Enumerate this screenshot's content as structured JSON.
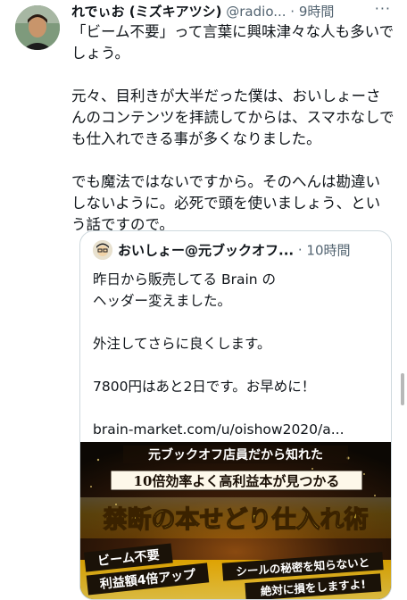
{
  "tweet": {
    "author_name": "れでぃお (ミズキアツシ)",
    "author_handle": "@radio...",
    "separator": " · ",
    "time": "9時間",
    "more": "···",
    "body": "「ビーム不要」って言葉に興味津々な人も多いでしょう。\n\n元々、目利きが大半だった僕は、おいしょーさんのコンテンツを拝読してからは、スマホなしでも仕入れできる事が多くなりました。\n\nでも魔法ではないですから。そのへんは勘違いしないように。必死で頭を使いましょう、という話ですので。"
  },
  "quote": {
    "author_name": "おいしょー@元ブックオフ...",
    "separator": " · ",
    "time": "10時間",
    "body": "昨日から販売してる Brain の\nヘッダー変えました。\n\n外注してさらに良くします。\n\n7800円はあと2日です。お早めに！\n\nbrain-market.com/u/oishow2020/a..."
  },
  "banner": {
    "line1": "元ブックオフ店員だから知れた",
    "line2": "10倍効率よく高利益本が見つかる",
    "title": "禁断の本せどり仕入れ術",
    "badge_left_1": "ビーム不要",
    "badge_left_2": "利益額4倍アップ",
    "badge_right_1": "シールの秘密を知らないと",
    "badge_right_2": "絶対に損をしますよ!"
  },
  "colors": {
    "text": "#0f1419",
    "secondary": "#536471",
    "border": "#cfd9de",
    "banner_gold": "#f5c400",
    "banner_dark": "#1a1208"
  }
}
